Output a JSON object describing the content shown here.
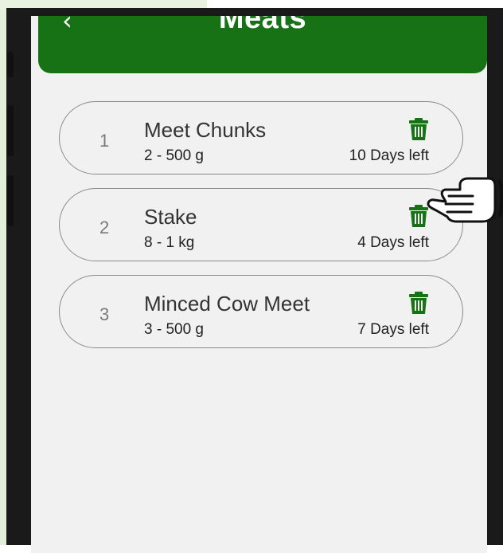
{
  "header": {
    "title": "Meats",
    "back_icon": "chevron-left-icon"
  },
  "items": [
    {
      "index": "1",
      "name": "Meet Chunks",
      "quantity": "2 - 500 g",
      "days_left": "10 Days left",
      "delete_icon": "trash-icon"
    },
    {
      "index": "2",
      "name": "Stake",
      "quantity": "8 - 1 kg",
      "days_left": "4 Days left",
      "delete_icon": "trash-icon"
    },
    {
      "index": "3",
      "name": "Minced Cow Meet",
      "quantity": "3 - 500 g",
      "days_left": "7 Days left",
      "delete_icon": "trash-icon"
    }
  ],
  "colors": {
    "accent": "#167214",
    "background": "#f1f1f1",
    "frame": "#1a1a1a"
  },
  "overlay": {
    "cursor_icon": "pointing-hand-icon"
  }
}
